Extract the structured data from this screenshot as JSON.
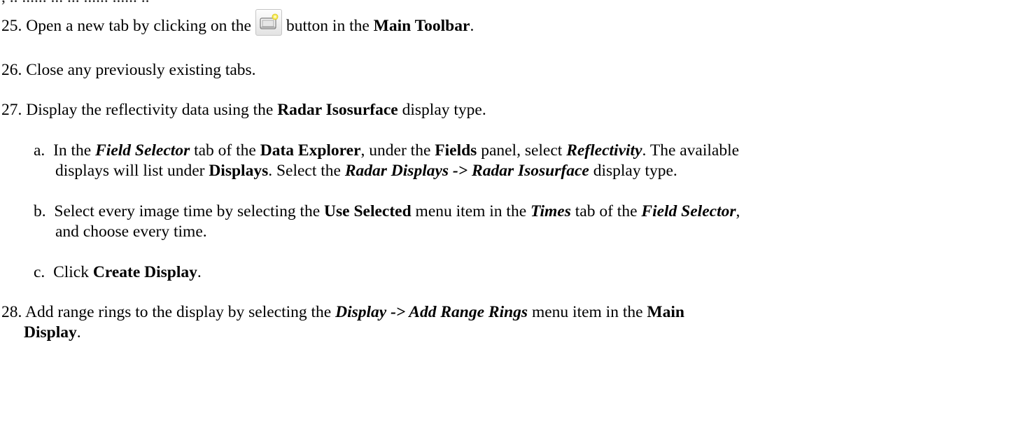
{
  "top_fragment": ", .. ...... ... ... ...... ...... ..",
  "steps": {
    "s25": {
      "num": "25.",
      "pre": "Open a new tab by clicking on the",
      "post": "button in the",
      "bold": "Main Toolbar",
      "end": "."
    },
    "s26": {
      "num": "26.",
      "text": "Close any previously existing tabs."
    },
    "s27": {
      "num": "27.",
      "pre": "Display the reflectivity data using the",
      "bold": "Radar Isosurface",
      "post": "display type."
    },
    "s27a": {
      "letter": "a.",
      "t1": "In the",
      "bi1": "Field Selector",
      "t2": "tab of the",
      "b1": "Data Explorer",
      "t3": ", under the",
      "b2": "Fields",
      "t4": "panel, select",
      "bi2": "Reflectivity",
      "t5": ". The available",
      "l2_t1": "displays will list under",
      "l2_b1": "Displays",
      "l2_t2": ". Select the",
      "l2_bi1": "Radar Displays -> Radar Isosurface",
      "l2_t3": "display type."
    },
    "s27b": {
      "letter": "b.",
      "t1": "Select every image time by selecting the",
      "b1": "Use Selected",
      "t2": "menu item in the",
      "bi1": "Times",
      "t3": "tab of the",
      "bi2": "Field Selector",
      "t4": ",",
      "l2": "and choose every time."
    },
    "s27c": {
      "letter": "c.",
      "t1": "Click",
      "b1": "Create Display",
      "t2": "."
    },
    "s28": {
      "num": "28.",
      "t1": "Add range rings to the display by selecting the",
      "bi1": "Display -> Add Range Rings",
      "t2": "menu item in the",
      "b1": "Main",
      "l2_b1": "Display",
      "l2_t1": "."
    }
  },
  "icons": {
    "new_tab": "new-tab-icon"
  }
}
